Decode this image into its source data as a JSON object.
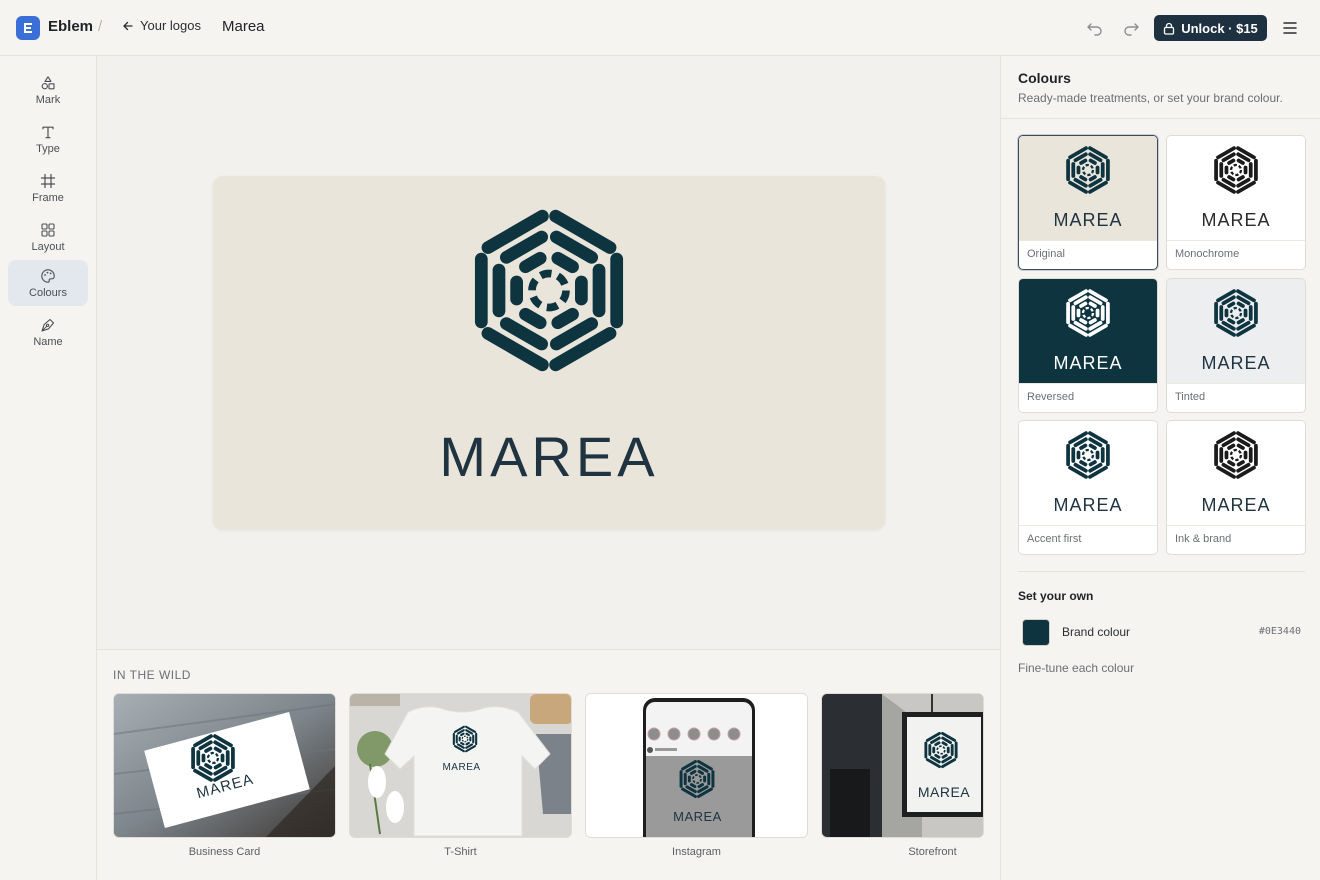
{
  "header": {
    "app_name": "Eblem",
    "separator": "/",
    "back_label": "Your logos",
    "logo_title": "Marea",
    "unlock_label": "Unlock · $15"
  },
  "rail": {
    "items": [
      {
        "label": "Mark",
        "icon": "shapes-icon"
      },
      {
        "label": "Type",
        "icon": "type-icon"
      },
      {
        "label": "Frame",
        "icon": "frame-icon"
      },
      {
        "label": "Layout",
        "icon": "layout-grid-icon"
      },
      {
        "label": "Colours",
        "icon": "palette-icon",
        "active": true
      },
      {
        "label": "Name",
        "icon": "pen-nib-icon"
      }
    ]
  },
  "canvas": {
    "wordmark": "MAREA",
    "card_color": "#e9e5db",
    "mark_color": "#0e3440",
    "word_color": "#1f3340"
  },
  "wild": {
    "heading": "IN THE WILD",
    "mockups": [
      {
        "label": "Business Card",
        "word": "MAREA"
      },
      {
        "label": "T-Shirt",
        "word": "MAREA"
      },
      {
        "label": "Instagram",
        "word": "MAREA"
      },
      {
        "label": "Storefront",
        "word": "MAREA"
      }
    ]
  },
  "panel": {
    "title": "Colours",
    "subtitle": "Ready-made treatments, or set your brand colour.",
    "treatments": [
      {
        "name": "Original",
        "word": "MAREA",
        "bg": "#e9e5db",
        "mark": "#0e3440",
        "text": "#1f3340",
        "selected": true
      },
      {
        "name": "Monochrome",
        "word": "MAREA",
        "bg": "#ffffff",
        "mark": "#1b1b1b",
        "text": "#2a2a2a"
      },
      {
        "name": "Reversed",
        "word": "MAREA",
        "bg": "#0e3440",
        "mark": "#ffffff",
        "text": "#ffffff"
      },
      {
        "name": "Tinted",
        "word": "MAREA",
        "bg": "#eceef0",
        "mark": "#0e3440",
        "text": "#1f3340"
      },
      {
        "name": "Accent first",
        "word": "MAREA",
        "bg": "#ffffff",
        "mark": "#0e3440",
        "text": "#1f3340"
      },
      {
        "name": "Ink & brand",
        "word": "MAREA",
        "bg": "#ffffff",
        "mark": "#1b1b1b",
        "text": "#1f3340"
      }
    ],
    "own_title": "Set your own",
    "brand_label": "Brand colour",
    "brand_hex": "#0E3440",
    "brand_color": "#0e3440",
    "finetune_label": "Fine-tune each colour"
  }
}
